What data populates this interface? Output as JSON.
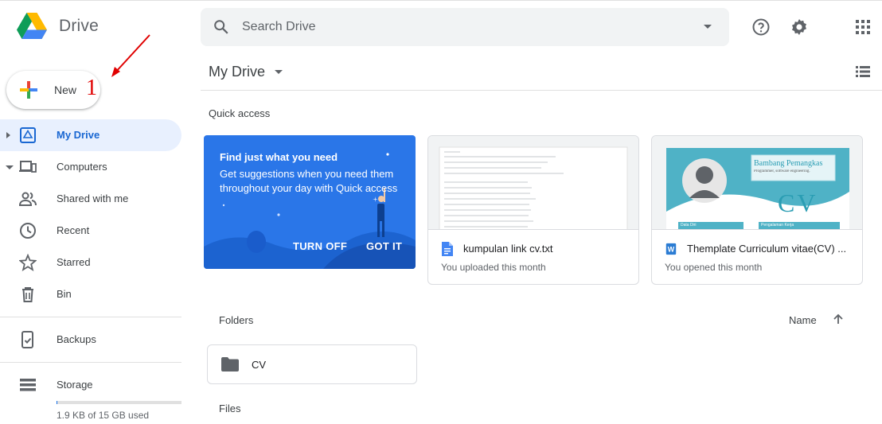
{
  "header": {
    "app_name": "Drive",
    "search_placeholder": "Search Drive"
  },
  "sidebar": {
    "new_label": "New",
    "items": [
      {
        "label": "My Drive"
      },
      {
        "label": "Computers"
      },
      {
        "label": "Shared with me"
      },
      {
        "label": "Recent"
      },
      {
        "label": "Starred"
      },
      {
        "label": "Bin"
      },
      {
        "label": "Backups"
      },
      {
        "label": "Storage"
      }
    ],
    "storage_used_text": "1.9 KB of 15 GB used",
    "storage_used_fraction": 1e-07
  },
  "annotation": {
    "number": "1",
    "color": "#e00000"
  },
  "main": {
    "title": "My Drive",
    "quick_access_label": "Quick access",
    "promo": {
      "heading": "Find just what you need",
      "body": "Get suggestions when you need them throughout your day with Quick access",
      "turn_off": "TURN OFF",
      "got_it": "GOT IT"
    },
    "cards": [
      {
        "title": "kumpulan link cv.txt",
        "subtitle": "You uploaded this month",
        "icon": "doc-icon"
      },
      {
        "title": "Themplate Curriculum vitae(CV) ...",
        "subtitle": "You opened this month",
        "icon": "word-icon"
      }
    ],
    "cv_thumb": {
      "name": "Bambang Pemangkas",
      "role": "Programmer, software engineering.",
      "big": "CV",
      "box1": "Data Diri",
      "box2": "Pengalaman Kerja"
    },
    "folders_label": "Folders",
    "sort_label": "Name",
    "folders": [
      {
        "name": "CV"
      }
    ],
    "files_label": "Files"
  },
  "colors": {
    "accent": "#1a73e8",
    "active_bg": "#e8f0fe",
    "promo_bg": "#2a76e8"
  }
}
